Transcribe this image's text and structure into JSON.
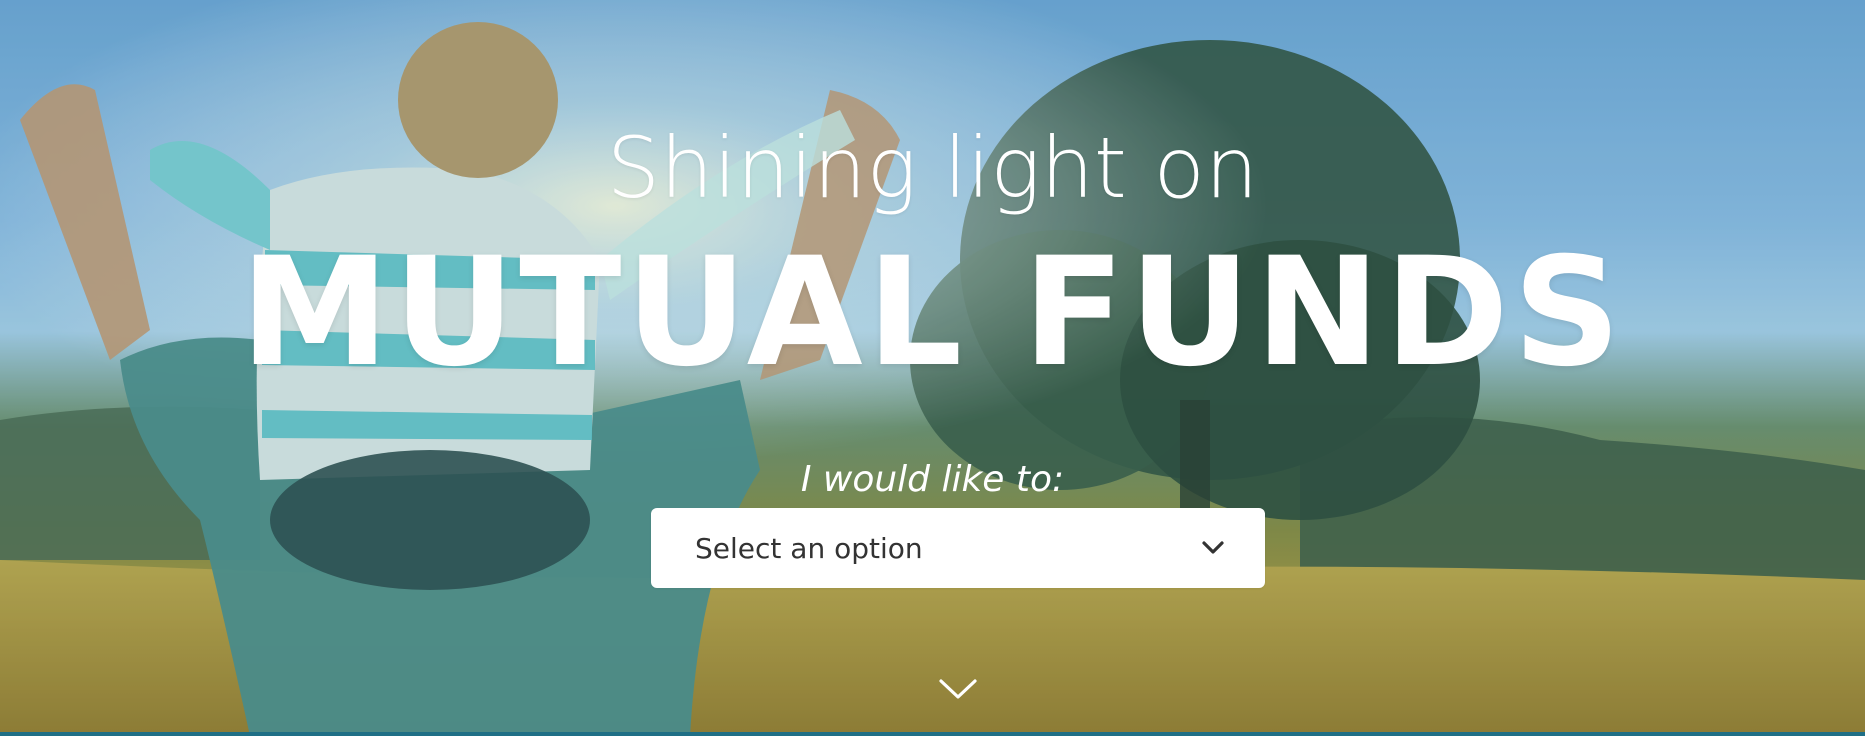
{
  "hero": {
    "headline_top": "Shining light on",
    "headline_main": "MUTUAL FUNDS",
    "prompt_label": "I would like to:",
    "select": {
      "selected": "Select an option",
      "icon": "chevron-down-icon"
    },
    "scroll_icon": "chevron-down-icon"
  },
  "colors": {
    "text": "#ffffff",
    "select_bg": "#ffffff",
    "select_text": "#333333",
    "bottom_strip": "#1f6f86"
  }
}
